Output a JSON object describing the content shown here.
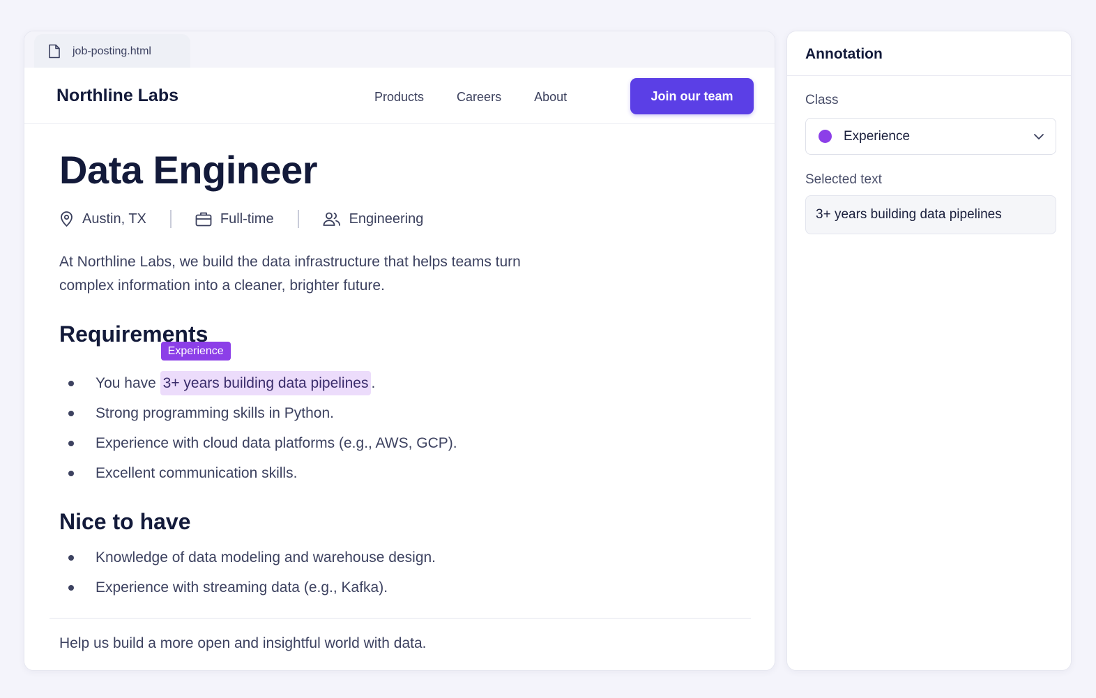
{
  "file_tab": {
    "name": "job-posting.html",
    "icon": "file-icon"
  },
  "navbar": {
    "brand": "Northline Labs",
    "links": [
      "Products",
      "Careers",
      "About"
    ],
    "cta": "Join our team"
  },
  "job": {
    "title": "Data Engineer",
    "meta": [
      {
        "icon": "location-pin-icon",
        "text": "Austin, TX"
      },
      {
        "icon": "briefcase-icon",
        "text": "Full-time"
      },
      {
        "icon": "users-icon",
        "text": "Engineering"
      }
    ],
    "intro": "At Northline Labs, we build the data infrastructure that helps teams turn complex information into a cleaner, brighter future.",
    "requirements_heading": "Requirements",
    "requirements": {
      "first_prefix": "You have ",
      "first_highlight": "3+ years building data pipelines",
      "first_suffix": ".",
      "highlight_tag": "Experience",
      "rest": [
        "Strong programming skills in Python.",
        "Experience with cloud data platforms (e.g., AWS, GCP).",
        "Excellent communication skills."
      ]
    },
    "nice_heading": "Nice to have",
    "nice": [
      "Knowledge of data modeling and warehouse design.",
      "Experience with streaming data (e.g., Kafka)."
    ],
    "footer": "Help us build a more open and insightful world with data."
  },
  "annotation": {
    "title": "Annotation",
    "class_label": "Class",
    "class_value": "Experience",
    "class_color": "#8c3fe8",
    "selected_label": "Selected text",
    "selected_value": "3+ years building data pipelines"
  },
  "colors": {
    "accent": "#5b3fe6",
    "highlight_bg": "#ecdcfb",
    "tag": "#8c3fe8"
  }
}
